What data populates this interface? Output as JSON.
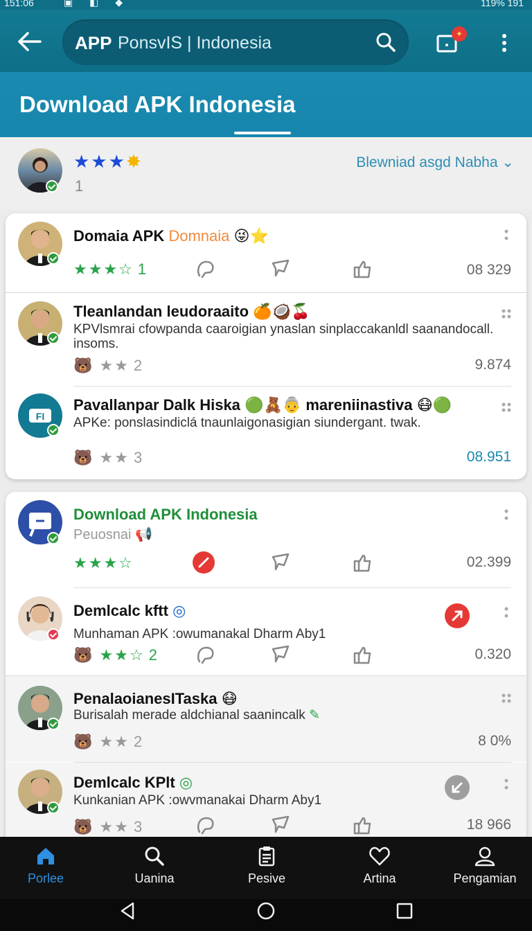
{
  "status_bar": {
    "time": "151:06",
    "right": "119%  191"
  },
  "appbar": {
    "brand": "APP",
    "search_text": "PonsvIS | Indonesia"
  },
  "hero": {
    "title": "Download APK Indonesia"
  },
  "summary": {
    "stars": "★★★",
    "count": "1",
    "sort_label": "Blewniad asgd Nabha"
  },
  "rows": [
    {
      "title": "Domaia APK",
      "accent": "Domnaia",
      "meta_stars": "★★★☆",
      "meta_count": "1",
      "value": "08 329"
    },
    {
      "title": "Tleanlandan leudoraaito",
      "subtitle": "KPVlsmrai cfowpanda caaroigian ynaslan sinplaccakanldl saanandocall. insoms.",
      "meta_stars": "★★",
      "meta_count": "2",
      "value": "9.874"
    },
    {
      "title": "Pavallanpar Dalk Hiska",
      "title_extra": "mareniinastiva",
      "subtitle": "APKe: ponslasindiclá tnaunlaigonasigian siundergant. twak.",
      "meta_stars": "★★",
      "meta_count": "3",
      "value": "08.951",
      "avatar_text": "FI"
    },
    {
      "title": "Download APK Indonesia",
      "subtitle": "Peuosnai",
      "meta_stars": "★★★☆",
      "value": "02.399"
    },
    {
      "title": "Demlcalc kftt",
      "subtitle": "Munhaman APK :owumanakal Dharm Aby1",
      "meta_stars": "★★☆",
      "meta_count": "2",
      "value": "0.320"
    },
    {
      "title": "PenalaoianesITaska",
      "subtitle": "Burisalah merade aldchianal saanincalk",
      "meta_stars": "★★",
      "meta_count": "2",
      "value": "8 0%"
    },
    {
      "title": "Demlcalc KPlt",
      "subtitle": "Kunkanian APK :owvmanakai Dharm Aby1",
      "meta_stars": "★★",
      "meta_count": "3",
      "value": "18 966"
    }
  ],
  "bottom_nav": [
    {
      "label": "Porlee",
      "icon": "home-icon"
    },
    {
      "label": "Uanina",
      "icon": "search-icon"
    },
    {
      "label": "Pesive",
      "icon": "clipboard-icon"
    },
    {
      "label": "Artina",
      "icon": "heart-icon"
    },
    {
      "label": "Pengamian",
      "icon": "person-icon"
    }
  ],
  "colors": {
    "primary": "#137a93",
    "accent_green": "#2aa34a",
    "star_blue": "#1b4bd8",
    "link_blue": "#2d8fb5",
    "danger": "#e53935"
  }
}
